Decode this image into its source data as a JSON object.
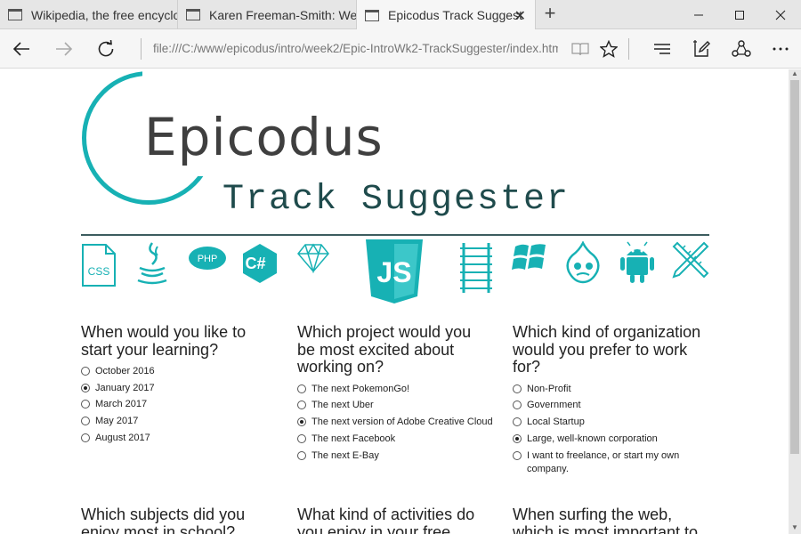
{
  "browser": {
    "tabs": [
      {
        "title": "Wikipedia, the free encyclop",
        "active": false
      },
      {
        "title": "Karen Freeman-Smith: Web",
        "active": false
      },
      {
        "title": "Epicodus Track Suggest",
        "active": true
      }
    ],
    "address": "file:///C:/www/epicodus/intro/week2/Epic-IntroWk2-TrackSuggester/index.html"
  },
  "header": {
    "brand": "Epicodus",
    "subtitle": "Track Suggester",
    "accent_color": "#17b1b4"
  },
  "tech_icons": [
    "css-icon",
    "java-icon",
    "php-icon",
    "csharp-icon",
    "sketch-icon",
    "javascript-icon",
    "rails-icon",
    "windows-icon",
    "drupal-icon",
    "android-icon",
    "design-tools-icon"
  ],
  "tech_labels": {
    "css": "CSS",
    "php": "PHP",
    "js": "JS",
    "csharp": "C#"
  },
  "questions": [
    {
      "prompt": "When would you like to start your learning?",
      "options": [
        "October 2016",
        "January 2017",
        "March 2017",
        "May 2017",
        "August 2017"
      ],
      "selected": 1
    },
    {
      "prompt": "Which project would you be most excited about working on?",
      "options": [
        "The next PokemonGo!",
        "The next Uber",
        "The next version of Adobe Creative Cloud",
        "The next Facebook",
        "The next E-Bay"
      ],
      "selected": 2
    },
    {
      "prompt": "Which kind of organization would you prefer to work for?",
      "options": [
        "Non-Profit",
        "Government",
        "Local Startup",
        "Large, well-known corporation",
        "I want to freelance, or start my own company."
      ],
      "selected": 3
    }
  ],
  "questions_row2": [
    {
      "prompt": "Which subjects did you enjoy most in school?"
    },
    {
      "prompt": "What kind of activities do you enjoy in your free time?"
    },
    {
      "prompt": "When surfing the web, which is most important to you?"
    }
  ]
}
